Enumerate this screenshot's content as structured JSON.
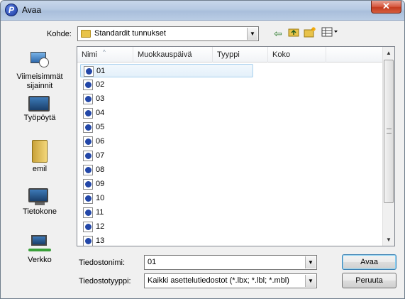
{
  "window": {
    "title": "Avaa",
    "close_label": "✕"
  },
  "location": {
    "label": "Kohde:",
    "value": "Standardit tunnukset"
  },
  "places": [
    {
      "label": "Viimeisimmät sijainnit",
      "icon": "recent-places-icon"
    },
    {
      "label": "Työpöytä",
      "icon": "desktop-icon"
    },
    {
      "label": "emil",
      "icon": "user-folder-icon"
    },
    {
      "label": "Tietokone",
      "icon": "computer-icon"
    },
    {
      "label": "Verkko",
      "icon": "network-icon"
    }
  ],
  "columns": [
    "Nimi",
    "Muokkauspäivä",
    "Tyyppi",
    "Koko"
  ],
  "files": [
    "01",
    "02",
    "03",
    "04",
    "05",
    "06",
    "07",
    "08",
    "09",
    "10",
    "11",
    "12",
    "13"
  ],
  "filename": {
    "label": "Tiedostonimi:",
    "value": "01"
  },
  "filetype": {
    "label": "Tiedostotyyppi:",
    "value": "Kaikki asettelutiedostot (*.lbx; *.lbl; *.mbl)"
  },
  "buttons": {
    "open": "Avaa",
    "cancel": "Peruuta"
  }
}
